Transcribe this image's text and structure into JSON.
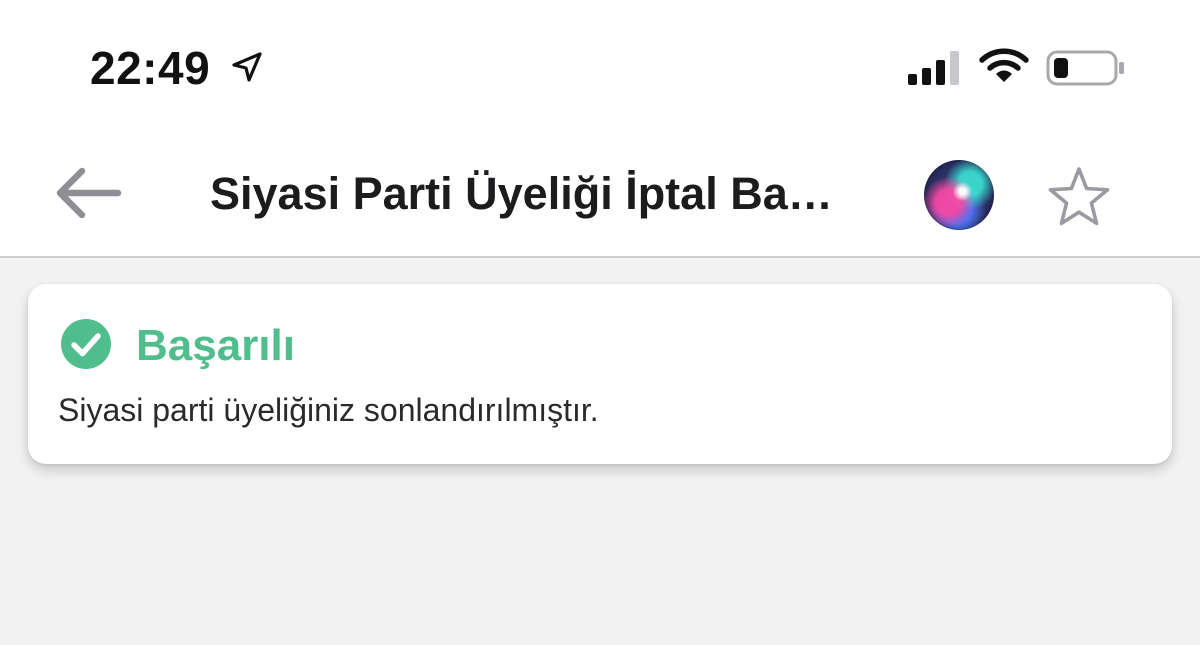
{
  "status_bar": {
    "time": "22:49",
    "icons": [
      "location-arrow-icon",
      "cellular-signal-icon",
      "wifi-icon",
      "battery-icon"
    ]
  },
  "nav": {
    "title": "Siyasi Parti Üyeliği İptal Ba…",
    "icons": [
      "back-arrow-icon",
      "siri-icon",
      "star-icon"
    ]
  },
  "alert": {
    "title": "Başarılı",
    "message": "Siyasi parti üyeliğiniz sonlandırılmıştır.",
    "icon": "check-circle-icon"
  },
  "colors": {
    "success": "#4fbe8c",
    "icon_gray": "#8e8e93",
    "background": "#f2f2f3"
  }
}
